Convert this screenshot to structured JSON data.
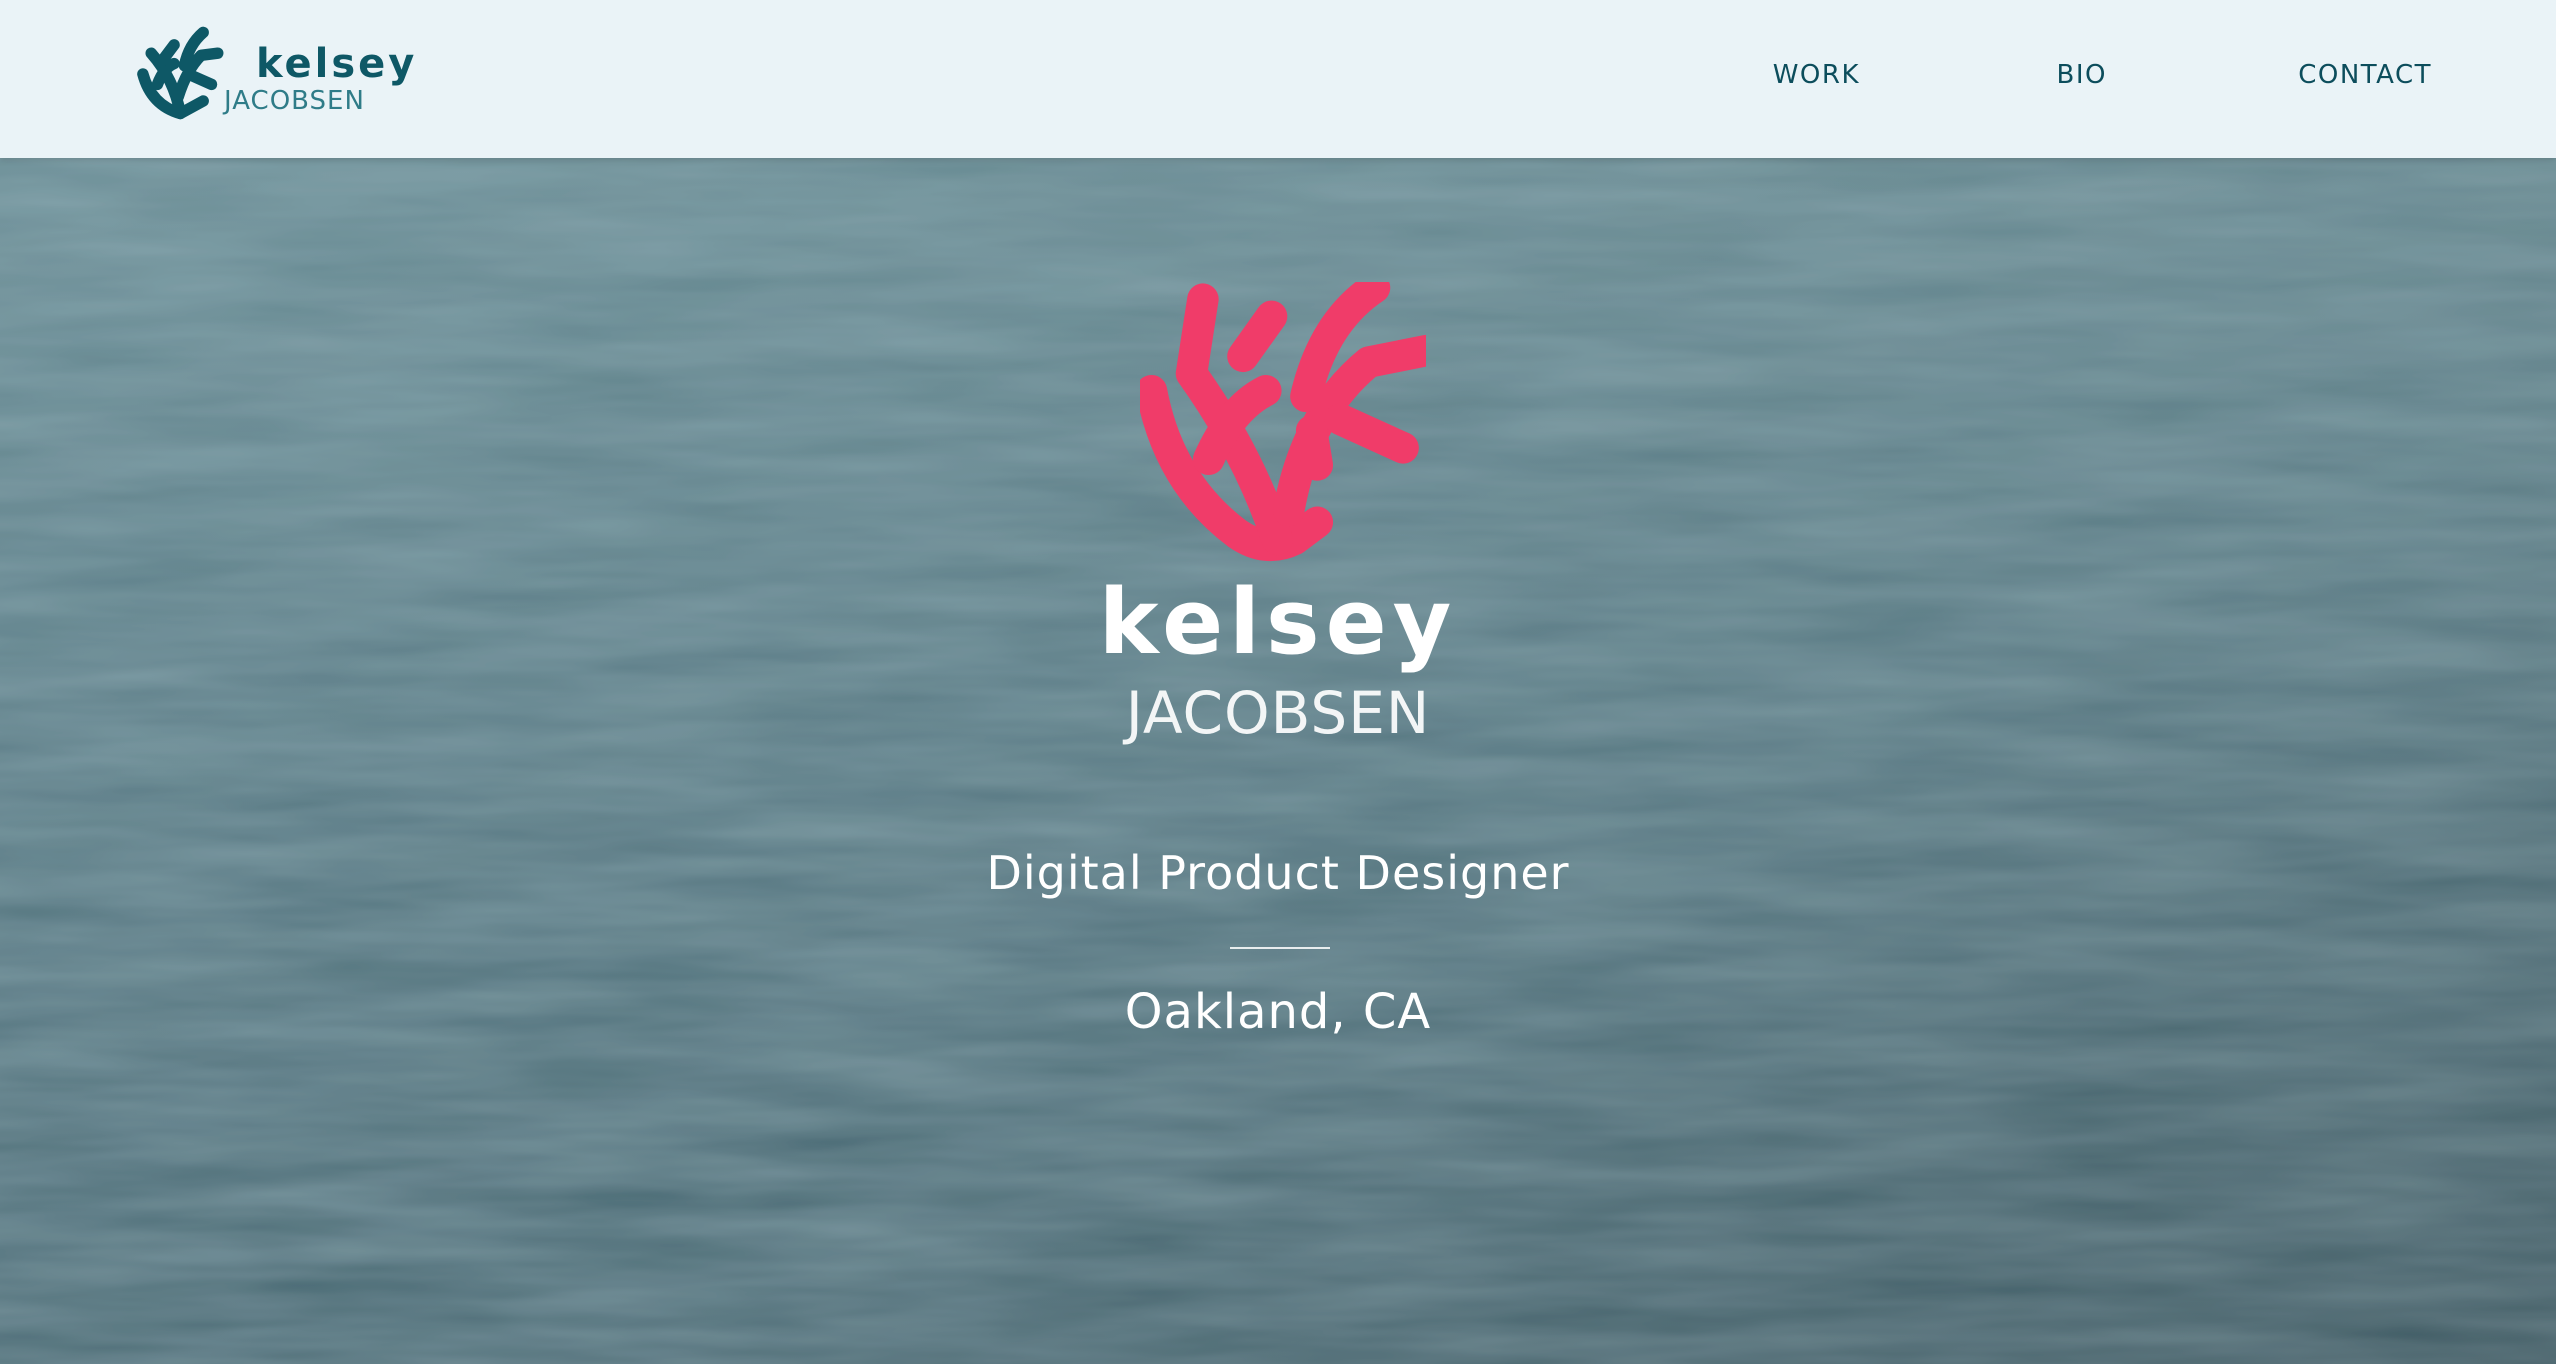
{
  "header": {
    "logo": {
      "name": "kelsey",
      "surname": "JACOBSEN",
      "icon": "coral-logo-icon",
      "color": "#0e5866"
    },
    "nav": [
      {
        "label": "WORK"
      },
      {
        "label": "BIO"
      },
      {
        "label": "CONTACT"
      }
    ]
  },
  "hero": {
    "background": "ocean-water-photo",
    "logo": {
      "icon": "coral-logo-icon",
      "color": "#f03c69",
      "name": "kelsey",
      "surname": "JACOBSEN"
    },
    "title": "Digital Product Designer",
    "location": "Oakland, CA"
  },
  "colors": {
    "header_bg": "#eaf3f7",
    "nav_text": "#0c4d5c",
    "accent": "#f03c69",
    "hero_text": "#ffffff"
  }
}
